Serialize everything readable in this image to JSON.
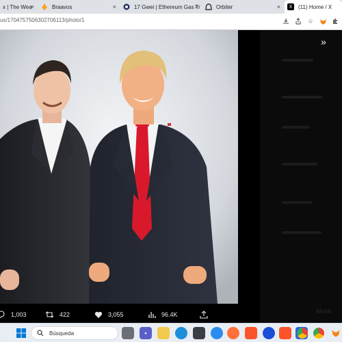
{
  "browser": {
    "tabs": [
      {
        "title": "x | The Wea",
        "favicon": "page-icon",
        "active": false
      },
      {
        "title": "Braavos",
        "favicon": "braavos-icon",
        "active": false
      },
      {
        "title": "17 Gwei | Ethereum Gas Tr",
        "favicon": "etherscan-icon",
        "active": false
      },
      {
        "title": "Orbiter",
        "favicon": "orbiter-icon",
        "active": false
      },
      {
        "title": "(11) Home / X",
        "favicon": "x-logo-icon",
        "active": true
      }
    ],
    "url": "us/1704757506302706113/photo/1",
    "toolbar_icons": [
      "download-icon",
      "share-icon",
      "bookmark-star-icon",
      "metamask-icon",
      "extension-icon"
    ]
  },
  "viewer": {
    "collapse_icon": "double-chevron-right-icon",
    "actions": {
      "replies": "1,003",
      "reposts": "422",
      "likes": "3,055",
      "views": "96.4K"
    },
    "corner_label": "Mostr"
  },
  "taskbar": {
    "search_placeholder": "Búsqueda",
    "apps": [
      "windows-start-icon",
      "search-icon",
      "task-view-icon",
      "teams-icon",
      "file-explorer-icon",
      "edge-icon",
      "store-icon",
      "thunderbird-icon",
      "firefox-icon",
      "brave-icon",
      "arc-icon",
      "brave-alt-icon",
      "dapp-icon",
      "chrome-icon",
      "chrome-profile-icon",
      "metamask-icon"
    ]
  },
  "colors": {
    "tabstrip": "#dee1e6",
    "viewer_bg": "#000000",
    "taskbar": "#e9eef4",
    "tie": "#d9192b"
  }
}
